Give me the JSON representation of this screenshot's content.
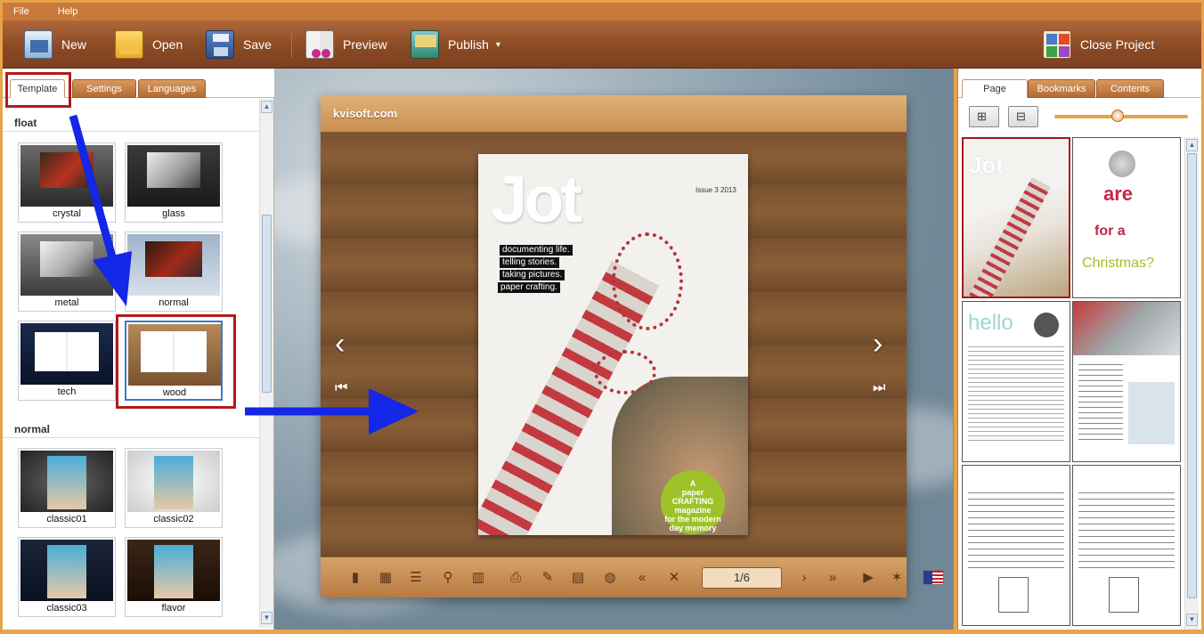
{
  "menu": {
    "items": [
      "File",
      "Help"
    ]
  },
  "toolbar": {
    "new_label": "New",
    "open_label": "Open",
    "save_label": "Save",
    "preview_label": "Preview",
    "publish_label": "Publish",
    "close_label": "Close Project"
  },
  "left_panel": {
    "tabs": [
      "Template",
      "Settings",
      "Languages"
    ],
    "active_tab": "Template",
    "sections": [
      {
        "title": "float",
        "templates": [
          "crystal",
          "glass",
          "metal",
          "normal",
          "tech",
          "wood"
        ]
      },
      {
        "title": "normal",
        "templates": [
          "classic01",
          "classic02",
          "classic03",
          "flavor"
        ]
      }
    ],
    "selected_template": "wood"
  },
  "book": {
    "site_label": "kvisoft.com",
    "page_indicator": "1/6",
    "cover": {
      "title": "Jot",
      "issue": "Issue 3 2013",
      "taglines": [
        "documenting life.",
        "telling stories.",
        "taking pictures.",
        "paper crafting."
      ],
      "badge_lines": [
        "A",
        "paper",
        "CRAFTING",
        "magazine",
        "for the modern",
        "day memory"
      ]
    }
  },
  "right_panel": {
    "tabs": [
      "Page",
      "Bookmarks",
      "Contents"
    ],
    "active_tab": "Page",
    "zoom_level": 0.45,
    "thumb_count": 6
  },
  "colors": {
    "toolbar_brown": "#8b4a24",
    "accent_orange": "#e8a24a",
    "annotation_red": "#b31a1a",
    "annotation_blue": "#1426e6"
  }
}
